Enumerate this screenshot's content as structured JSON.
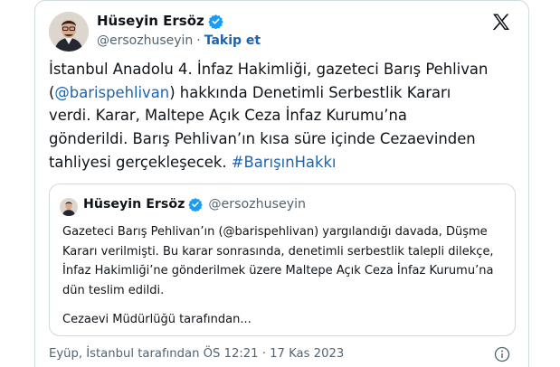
{
  "author": {
    "name": "Hüseyin Ersöz",
    "handle": "@ersozhuseyin",
    "separator": "·",
    "follow_label": "Takip et"
  },
  "tweet": {
    "line1": "İstanbul Anadolu 4. İnfaz Hakimliği, gazeteci Barış Pehlivan",
    "line2_prefix": "(",
    "mention": "@barispehlivan",
    "line2_suffix": ") hakkında Denetimli Serbestlik Kararı",
    "line3": "verdi. Karar, Maltepe Açık Ceza İnfaz Kurumu’na",
    "line4": "gönderildi. Barış Pehlivan’ın kısa süre içinde Cezaevinden",
    "line5_prefix": "tahliyesi gerçekleşecek. ",
    "hashtag": "#BarışınHakkı"
  },
  "quote": {
    "name": "Hüseyin Ersöz",
    "handle": "@ersozhuseyin",
    "lines": [
      "Gazeteci Barış Pehlivan’ın (@barispehlivan) yargılandığı davada, Düşme",
      "Kararı verilmişti. Bu karar sonrasında, denetimli serbestlik talepli dilekçe,",
      "İnfaz Hakimliği’ne gönderilmek üzere Maltepe Açık Ceza İnfaz Kurumu’na",
      "dün teslim edildi."
    ],
    "more": "Cezaevi Müdürlüğü tarafından..."
  },
  "meta": {
    "text": "Eyüp, İstanbul tarafından ÖS 12:21 · 17 Kas 2023"
  },
  "colors": {
    "link": "#1d63ad",
    "verified": "#1d9bf0",
    "muted": "#536471",
    "border": "#cfd9de"
  },
  "icons": {
    "verified": "verified-badge-icon",
    "brand": "x-logo-icon",
    "info": "info-icon"
  }
}
